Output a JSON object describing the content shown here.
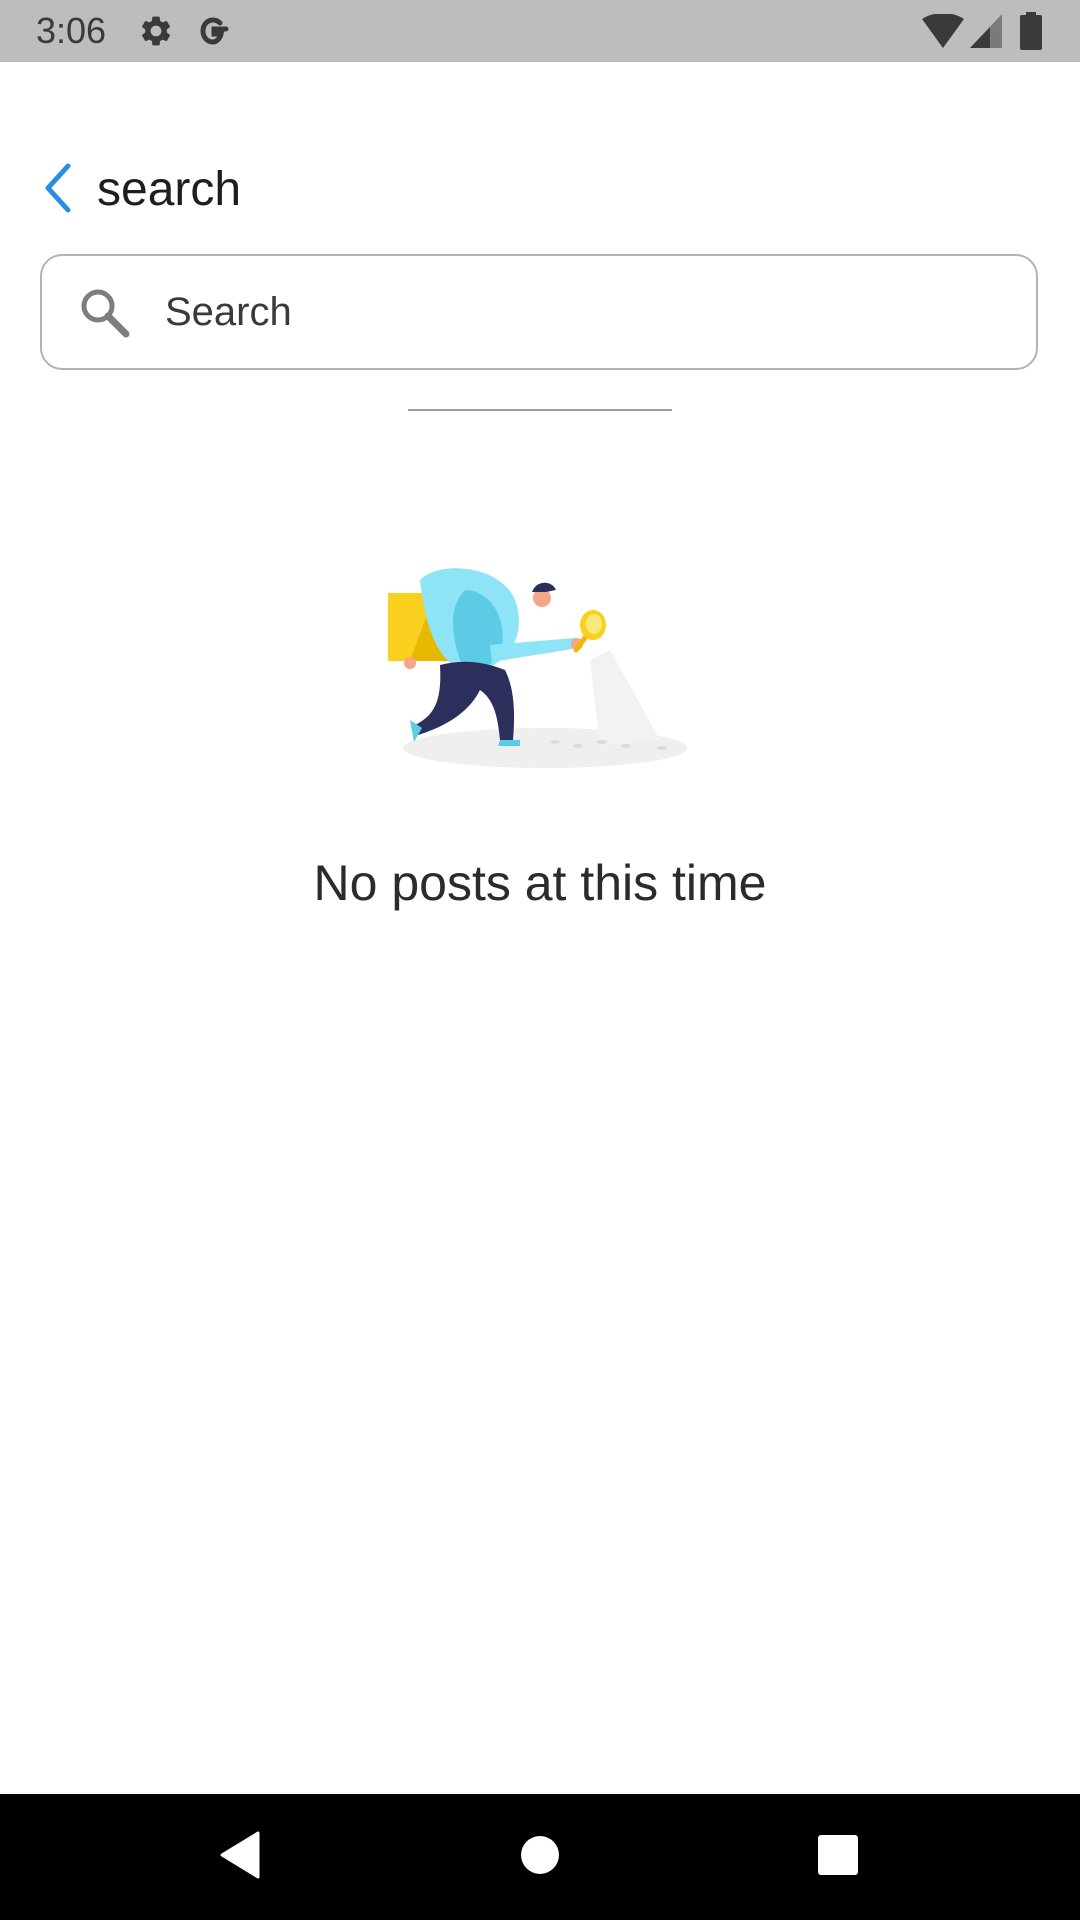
{
  "status_bar": {
    "time": "3:06",
    "icons": [
      "gear-icon",
      "google-g-icon",
      "wifi-icon",
      "signal-icon",
      "battery-icon"
    ]
  },
  "header": {
    "back_icon": "chevron-left-icon",
    "title": "search"
  },
  "search": {
    "icon": "search-icon",
    "placeholder": "Search",
    "value": ""
  },
  "empty_state": {
    "illustration": "person-with-magnifying-glass-illustration",
    "message": "No posts at this time"
  },
  "nav_bar": {
    "buttons": [
      "back-triangle-icon",
      "home-circle-icon",
      "recents-square-icon"
    ]
  },
  "colors": {
    "accent": "#2a8de4",
    "status_bar": "#bdbdbd",
    "nav_bar": "#000000",
    "text": "#1e1e1e",
    "border": "#b3b3b3"
  }
}
